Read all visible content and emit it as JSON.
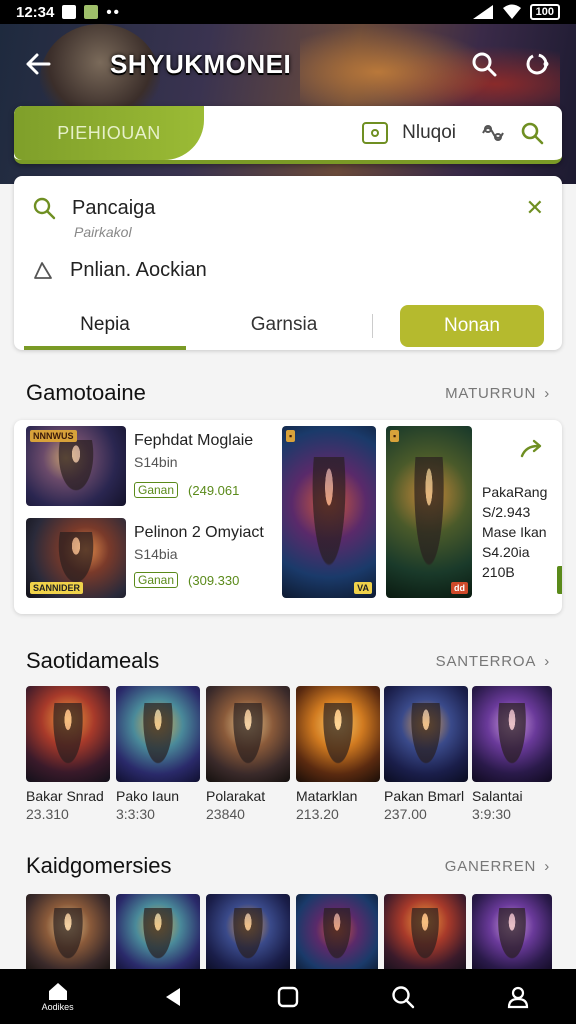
{
  "status": {
    "time": "12:34",
    "battery": "100"
  },
  "app": {
    "title": "SHYUKMONEI"
  },
  "top_tabs": {
    "active": "PIEHIOUAN",
    "secondary": "Nluqoi"
  },
  "search": {
    "query": "Pancaiga",
    "hint": "Pairkakol",
    "location": "Pnlian. Aockian",
    "tab1": "Nepia",
    "tab2": "Garnsia",
    "button": "Nonan"
  },
  "featured": {
    "title": "Gamotoaine",
    "more": "MATURRUN",
    "items": [
      {
        "name": "Fephdat Moglaie",
        "sub": "S14bin",
        "tag": "Ganan",
        "price": "(249.061"
      },
      {
        "name": "Pelinon 2 Omyiact",
        "sub": "S14bia",
        "tag": "Ganan",
        "price": "(309.330"
      }
    ],
    "side": [
      "PakaRang",
      "S/2.943",
      "Mase Ikan",
      "S4.20ia",
      "210B"
    ],
    "badge_d": "VA",
    "badge_e": "dd",
    "badge_a": "NNNWUS",
    "badge_b": "SANNIDER"
  },
  "section2": {
    "title": "Saotidameals",
    "more": "SANTERROA",
    "items": [
      {
        "name": "Bakar Snrad",
        "price": "23.310"
      },
      {
        "name": "Pako Iaun",
        "price": "3:3:30"
      },
      {
        "name": "Polarakat",
        "price": "23840"
      },
      {
        "name": "Matarklan",
        "price": "213.20"
      },
      {
        "name": "Pakan Bmarl",
        "price": "237.00"
      },
      {
        "name": "Salantai",
        "price": "3:9:30"
      }
    ]
  },
  "section3": {
    "title": "Kaidgomersies",
    "more": "GANERREN"
  },
  "nav": {
    "home_label": "Aodikes"
  },
  "colors": {
    "accent": "#7a9a26",
    "button": "#b5ba2e"
  }
}
